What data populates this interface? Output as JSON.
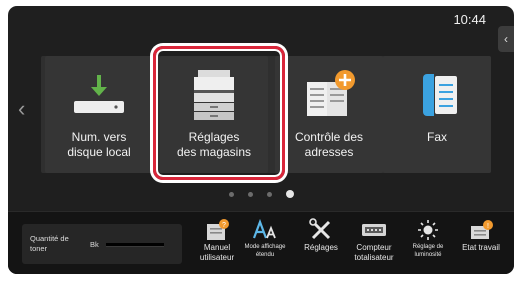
{
  "status": {
    "time": "10:44"
  },
  "nav": {
    "left_arrow": "‹",
    "side_tab_arrow": "‹"
  },
  "tiles": [
    {
      "label": "Num. vers\ndisque local",
      "icon": "usb-drive-icon"
    },
    {
      "label": "Réglages\ndes magasins",
      "icon": "printer-tray-icon",
      "highlighted": true
    },
    {
      "label": "Contrôle des\nadresses",
      "icon": "address-book-add-icon"
    },
    {
      "label": "Fax",
      "icon": "fax-phone-icon"
    }
  ],
  "pager": {
    "count": 4,
    "active_index": 3
  },
  "toner": {
    "label": "Quantité de toner",
    "color_label": "Bk",
    "level": 0.0
  },
  "functions": [
    {
      "label": "Manuel\nutilisateur",
      "icon": "manual-icon"
    },
    {
      "label": "Mode affichage\nétendu",
      "icon": "text-size-icon",
      "small": true
    },
    {
      "label": "Réglages",
      "icon": "tools-icon"
    },
    {
      "label": "Compteur\ntotalisateur",
      "icon": "counter-icon"
    },
    {
      "label": "Réglage de\nluminosité",
      "icon": "brightness-icon",
      "small": true
    },
    {
      "label": "Etat travail",
      "icon": "job-status-icon"
    }
  ],
  "colors": {
    "accent_orange": "#f29a2e",
    "highlight_red": "#d9263a",
    "fax_blue": "#3ba2e0",
    "usb_green": "#62b34a"
  }
}
